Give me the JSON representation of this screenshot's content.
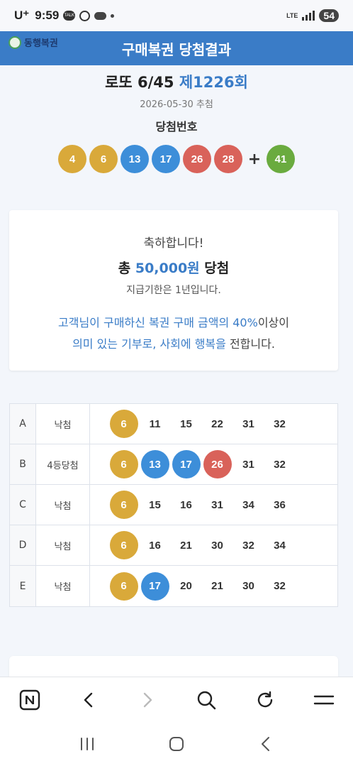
{
  "status": {
    "carrier": "U⁺",
    "time": "9:59",
    "network": "LTE",
    "battery": "54"
  },
  "header": {
    "logo_text": "동행복권",
    "title": "구매복권 당첨결과"
  },
  "draw": {
    "game": "로또 6/45",
    "round": "제1226회",
    "date": "2026-05-30 추첨",
    "numbers_label": "당첨번호",
    "numbers": [
      4,
      6,
      13,
      17,
      26,
      28
    ],
    "plus": "+",
    "bonus": 41
  },
  "prize": {
    "congrats": "축하합니다!",
    "total_prefix": "총",
    "amount": "50,000원",
    "total_suffix": "당첨",
    "deadline": "지급기한은 1년입니다.",
    "msg_line1_a": "고객님이 구매하신 복권 구매 금액의 40%",
    "msg_line1_b": "이상이",
    "msg_line2_a": "의미 있는 기부로, 사회에 행복을",
    "msg_line2_b": " 전합니다."
  },
  "tickets": [
    {
      "id": "A",
      "status": "낙첨",
      "numbers": [
        6,
        11,
        15,
        22,
        31,
        32
      ],
      "hits": [
        6
      ]
    },
    {
      "id": "B",
      "status": "4등당첨",
      "numbers": [
        6,
        13,
        17,
        26,
        31,
        32
      ],
      "hits": [
        6,
        13,
        17,
        26
      ]
    },
    {
      "id": "C",
      "status": "낙첨",
      "numbers": [
        6,
        15,
        16,
        31,
        34,
        36
      ],
      "hits": [
        6
      ]
    },
    {
      "id": "D",
      "status": "낙첨",
      "numbers": [
        6,
        16,
        21,
        30,
        32,
        34
      ],
      "hits": [
        6
      ]
    },
    {
      "id": "E",
      "status": "낙첨",
      "numbers": [
        6,
        17,
        20,
        21,
        30,
        32
      ],
      "hits": [
        6,
        17
      ]
    }
  ],
  "ball_colors": {
    "1-10": "#d9a93a",
    "11-20": "#3d8ed9",
    "21-30": "#d9625a",
    "31-40": "#8a8a8a",
    "41-45": "#6aab3f"
  },
  "toolbar": [
    "naver-icon",
    "back-icon",
    "forward-icon",
    "search-icon",
    "refresh-icon",
    "menu-icon"
  ],
  "navbar": [
    "recents-icon",
    "home-icon",
    "back-nav-icon"
  ]
}
